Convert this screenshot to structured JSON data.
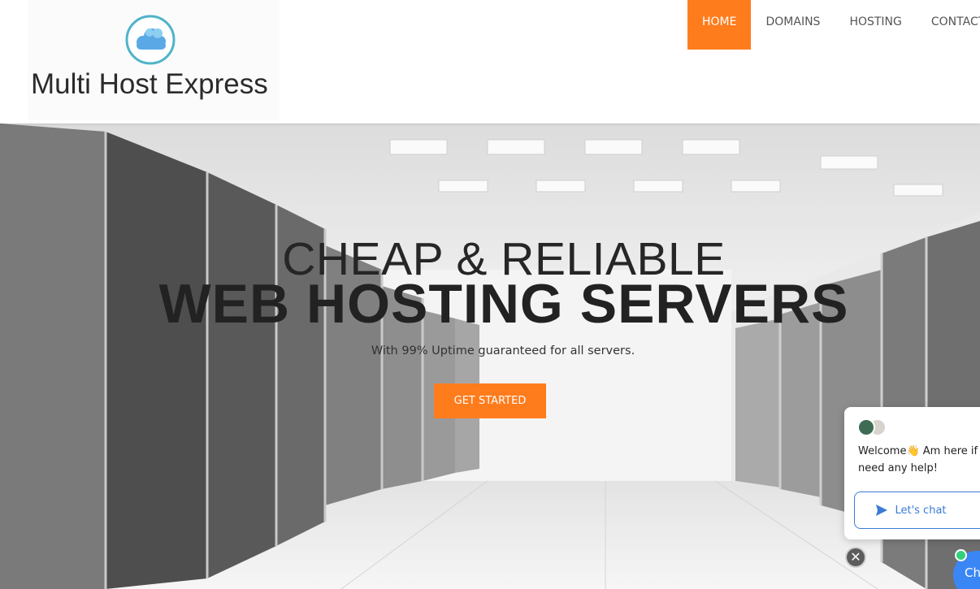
{
  "brand": {
    "name": "Multi Host Express",
    "logo_icon": "cloud-icon"
  },
  "nav": {
    "items": [
      {
        "label": "HOME",
        "active": true
      },
      {
        "label": "DOMAINS",
        "active": false
      },
      {
        "label": "HOSTING",
        "active": false
      },
      {
        "label": "CONTACT",
        "active": false
      }
    ]
  },
  "hero": {
    "title_line1": "CHEAP & RELIABLE",
    "title_line2": "WEB HOSTING SERVERS",
    "subtitle": "With 99% Uptime guaranteed for all servers.",
    "cta_label": "GET STARTED"
  },
  "chat": {
    "message_line1": "Welcome👋 Am here if y",
    "message_line2": "need any help!",
    "button_label": "Let's chat",
    "close_symbol": "✕",
    "launcher_label": "Ch"
  },
  "colors": {
    "accent": "#ff7c1c",
    "chat_blue": "#3a7bd5",
    "online": "#33d17a"
  }
}
